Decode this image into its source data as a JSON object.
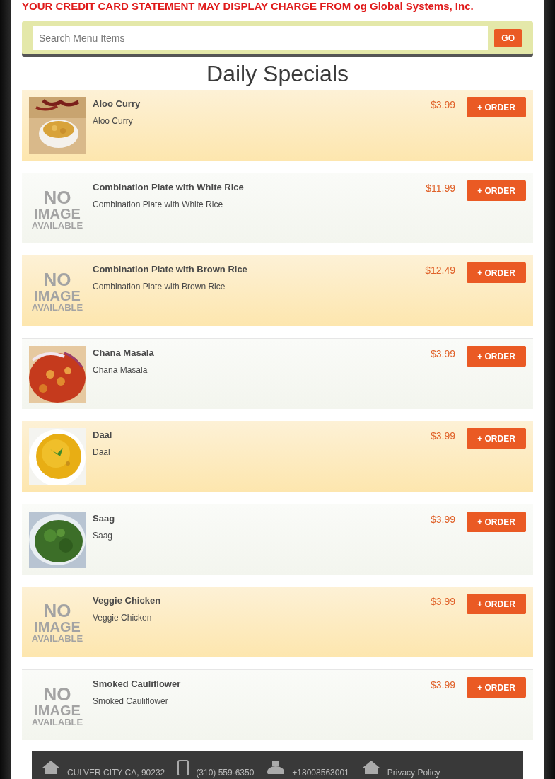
{
  "notice": "YOUR CREDIT CARD STATEMENT MAY DISPLAY CHARGE FROM og Global Systems, Inc.",
  "search": {
    "placeholder": "Search Menu Items",
    "button": "GO"
  },
  "heading": "Daily Specials",
  "items": [
    {
      "name": "Aloo Curry",
      "description": "Aloo Curry",
      "price": "$3.99",
      "button": "+ ORDER"
    },
    {
      "name": "Combination Plate with White Rice",
      "description": "Combination Plate with White Rice",
      "price": "$11.99",
      "button": "+ ORDER",
      "image": {
        "kind": "no-image",
        "lines": [
          "NO",
          "IMAGE",
          "AVAILABLE"
        ]
      }
    },
    {
      "name": "Combination Plate with Brown Rice",
      "description": "Combination Plate with Brown Rice",
      "price": "$12.49",
      "button": "+ ORDER",
      "image": {
        "kind": "no-image",
        "lines": [
          "NO",
          "IMAGE",
          "AVAILABLE"
        ]
      }
    },
    {
      "name": "Chana Masala",
      "description": "Chana Masala",
      "price": "$3.99",
      "button": "+ ORDER"
    },
    {
      "name": "Daal",
      "description": "Daal",
      "price": "$3.99",
      "button": "+ ORDER"
    },
    {
      "name": "Saag",
      "description": "Saag",
      "price": "$3.99",
      "button": "+ ORDER"
    },
    {
      "name": "Veggie Chicken",
      "description": "Veggie Chicken",
      "price": "$3.99",
      "button": "+ ORDER",
      "image": {
        "kind": "no-image",
        "lines": [
          "NO",
          "IMAGE",
          "AVAILABLE"
        ]
      }
    },
    {
      "name": "Smoked Cauliflower",
      "description": "Smoked Cauliflower",
      "price": "$3.99",
      "button": "+ ORDER",
      "image": {
        "kind": "no-image",
        "lines": [
          "NO",
          "IMAGE",
          "AVAILABLE"
        ]
      }
    }
  ],
  "footer": [
    {
      "kind": "address",
      "text": "CULVER CITY CA, 90232"
    },
    {
      "kind": "phone",
      "text": "(310) 559-6350"
    },
    {
      "kind": "fax",
      "text": "+18008563001"
    },
    {
      "kind": "policy",
      "text": "Privacy Policy"
    }
  ]
}
